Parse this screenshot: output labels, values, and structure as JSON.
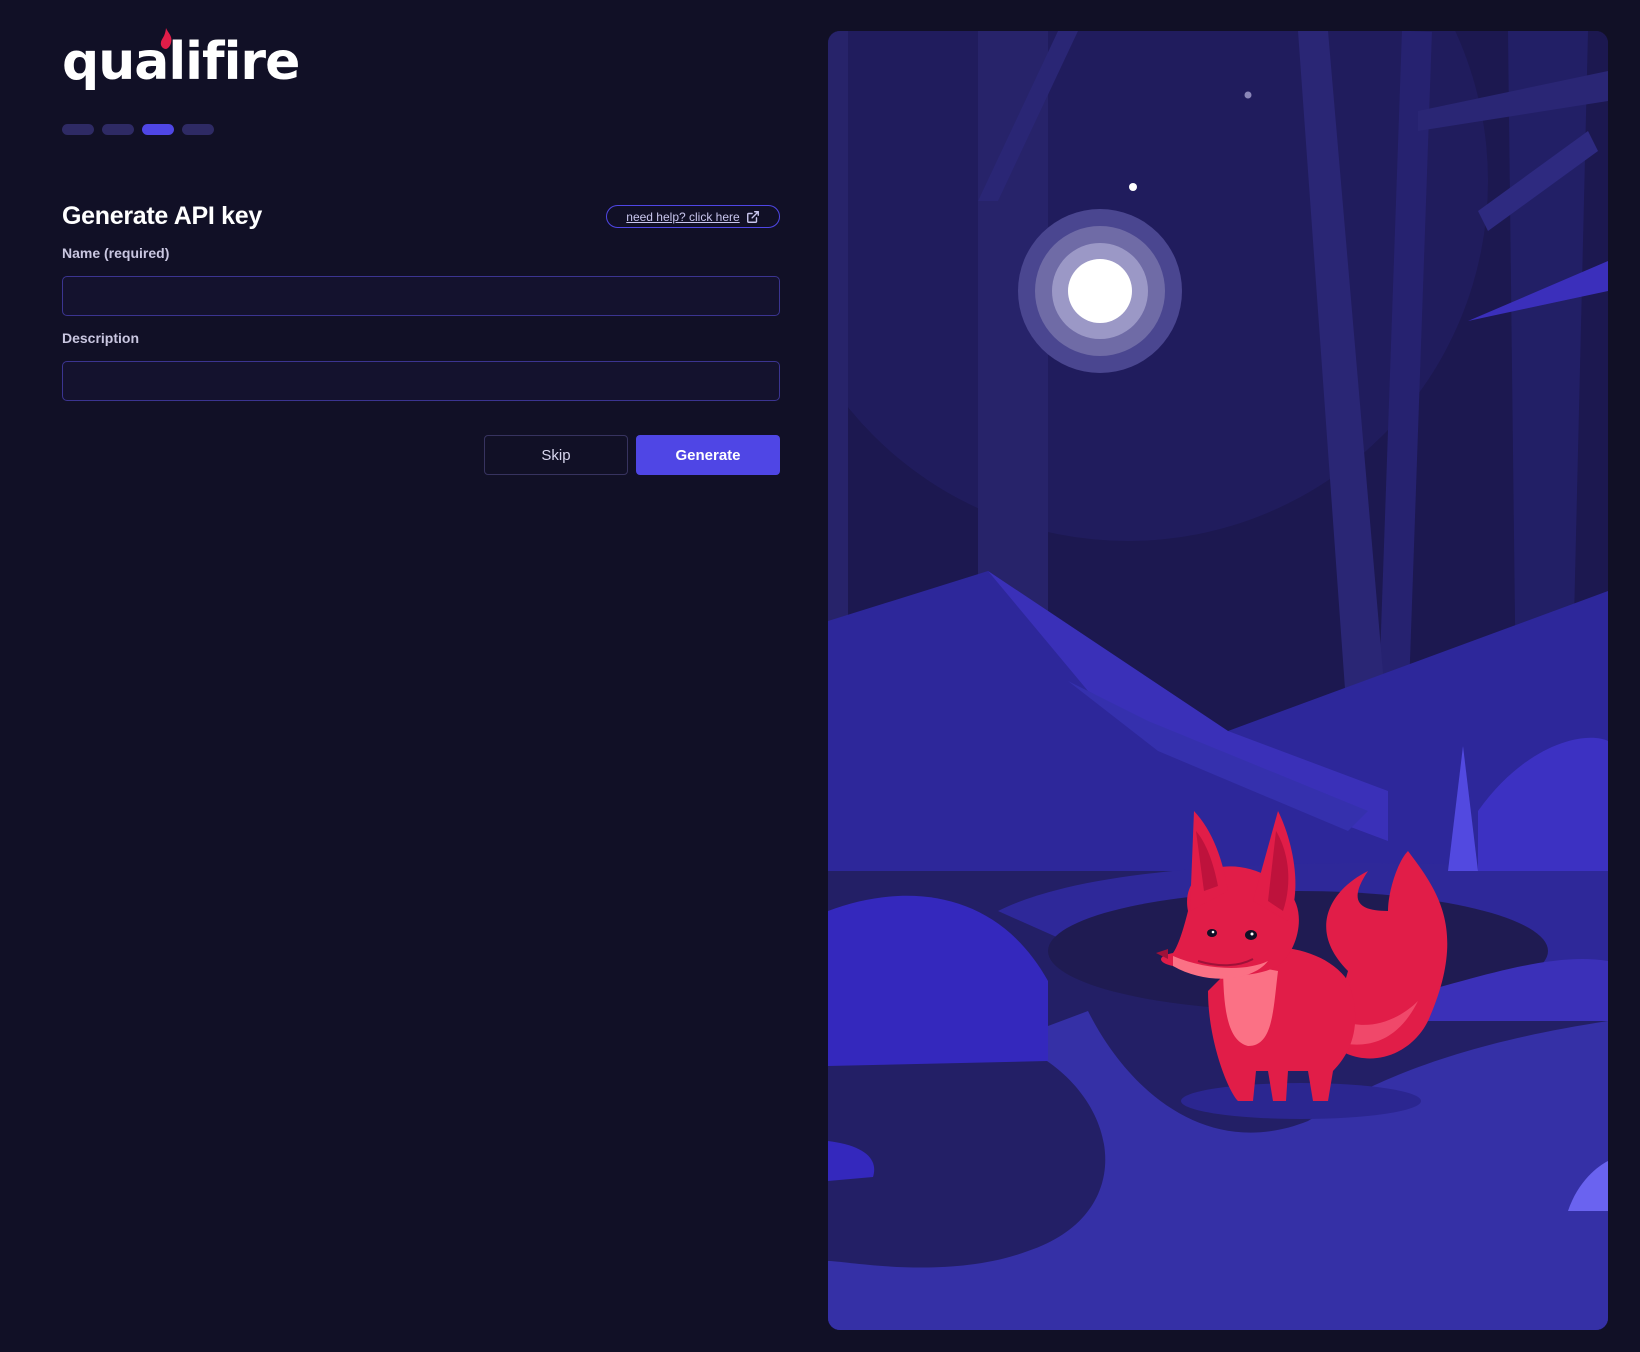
{
  "brand": {
    "name": "qualifire",
    "flame_color": "#e11d48"
  },
  "progress": {
    "total_steps": 4,
    "current_step": 3
  },
  "form": {
    "title": "Generate API key",
    "help_link": {
      "label": "need help? click here",
      "icon": "external-link-icon"
    },
    "name_label": "Name (required)",
    "name_value": "",
    "description_label": "Description",
    "description_value": "",
    "skip_label": "Skip",
    "generate_label": "Generate"
  },
  "colors": {
    "background": "#111026",
    "accent": "#4f46e5",
    "fox": "#e11d48"
  },
  "illustration": {
    "subject": "fox-in-moonlit-forest"
  }
}
